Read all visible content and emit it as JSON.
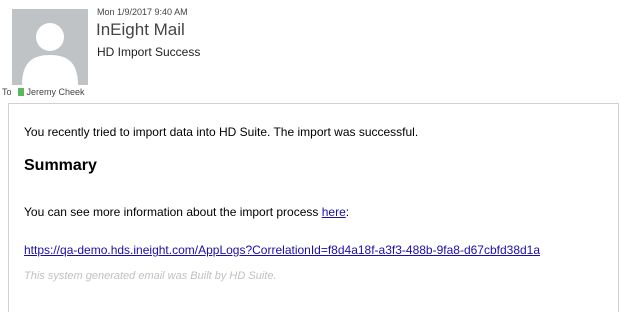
{
  "header": {
    "date": "Mon 1/9/2017 9:40 AM",
    "sender": "InEight Mail",
    "subject": "HD Import Success",
    "to_label": "To",
    "recipient": "Jeremy Cheek",
    "presence_color": "#5cb85c"
  },
  "body": {
    "intro": "You recently tried to import data into HD Suite. The import was successful.",
    "summary_heading": "Summary",
    "more_info_text": "You can see more information about the import process ",
    "more_info_link": "here",
    "more_info_suffix": ":",
    "log_url": "https://qa-demo.hds.ineight.com/AppLogs?CorrelationId=f8d4a18f-a3f3-488b-9fa8-d67cbfd38d1a",
    "footer": "This system generated email was Built by HD Suite."
  },
  "colors": {
    "link": "#1a0dab",
    "footer_text": "#c0c0c0",
    "avatar_bg": "#bfc3c6"
  }
}
